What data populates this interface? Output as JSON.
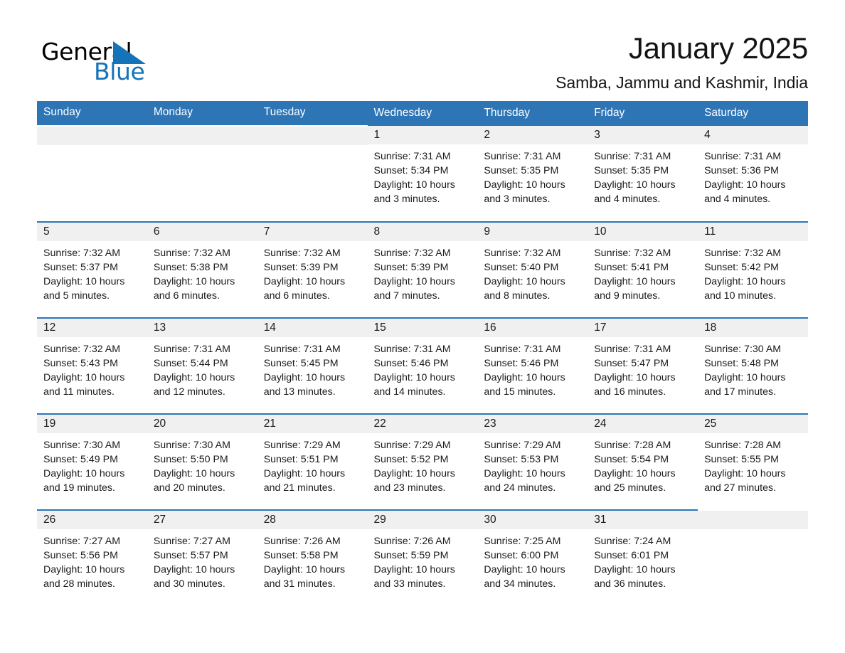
{
  "brand": {
    "word1": "General",
    "word2": "Blue",
    "triangle_color": "#1573b9",
    "triangle_icon": "triangle-logo-icon"
  },
  "header": {
    "title": "January 2025",
    "location": "Samba, Jammu and Kashmir, India"
  },
  "theme": {
    "header_blue": "#2e75b6",
    "daynum_band": "#f0f0f0",
    "text": "#1a1a1a"
  },
  "calendar": {
    "weekday_headers": [
      "Sunday",
      "Monday",
      "Tuesday",
      "Wednesday",
      "Thursday",
      "Friday",
      "Saturday"
    ],
    "weeks": [
      [
        {
          "empty": true
        },
        {
          "empty": true
        },
        {
          "empty": true
        },
        {
          "day": "1",
          "sunrise": "Sunrise: 7:31 AM",
          "sunset": "Sunset: 5:34 PM",
          "daylight_line1": "Daylight: 10 hours",
          "daylight_line2": "and 3 minutes."
        },
        {
          "day": "2",
          "sunrise": "Sunrise: 7:31 AM",
          "sunset": "Sunset: 5:35 PM",
          "daylight_line1": "Daylight: 10 hours",
          "daylight_line2": "and 3 minutes."
        },
        {
          "day": "3",
          "sunrise": "Sunrise: 7:31 AM",
          "sunset": "Sunset: 5:35 PM",
          "daylight_line1": "Daylight: 10 hours",
          "daylight_line2": "and 4 minutes."
        },
        {
          "day": "4",
          "sunrise": "Sunrise: 7:31 AM",
          "sunset": "Sunset: 5:36 PM",
          "daylight_line1": "Daylight: 10 hours",
          "daylight_line2": "and 4 minutes."
        }
      ],
      [
        {
          "day": "5",
          "sunrise": "Sunrise: 7:32 AM",
          "sunset": "Sunset: 5:37 PM",
          "daylight_line1": "Daylight: 10 hours",
          "daylight_line2": "and 5 minutes."
        },
        {
          "day": "6",
          "sunrise": "Sunrise: 7:32 AM",
          "sunset": "Sunset: 5:38 PM",
          "daylight_line1": "Daylight: 10 hours",
          "daylight_line2": "and 6 minutes."
        },
        {
          "day": "7",
          "sunrise": "Sunrise: 7:32 AM",
          "sunset": "Sunset: 5:39 PM",
          "daylight_line1": "Daylight: 10 hours",
          "daylight_line2": "and 6 minutes."
        },
        {
          "day": "8",
          "sunrise": "Sunrise: 7:32 AM",
          "sunset": "Sunset: 5:39 PM",
          "daylight_line1": "Daylight: 10 hours",
          "daylight_line2": "and 7 minutes."
        },
        {
          "day": "9",
          "sunrise": "Sunrise: 7:32 AM",
          "sunset": "Sunset: 5:40 PM",
          "daylight_line1": "Daylight: 10 hours",
          "daylight_line2": "and 8 minutes."
        },
        {
          "day": "10",
          "sunrise": "Sunrise: 7:32 AM",
          "sunset": "Sunset: 5:41 PM",
          "daylight_line1": "Daylight: 10 hours",
          "daylight_line2": "and 9 minutes."
        },
        {
          "day": "11",
          "sunrise": "Sunrise: 7:32 AM",
          "sunset": "Sunset: 5:42 PM",
          "daylight_line1": "Daylight: 10 hours",
          "daylight_line2": "and 10 minutes."
        }
      ],
      [
        {
          "day": "12",
          "sunrise": "Sunrise: 7:32 AM",
          "sunset": "Sunset: 5:43 PM",
          "daylight_line1": "Daylight: 10 hours",
          "daylight_line2": "and 11 minutes."
        },
        {
          "day": "13",
          "sunrise": "Sunrise: 7:31 AM",
          "sunset": "Sunset: 5:44 PM",
          "daylight_line1": "Daylight: 10 hours",
          "daylight_line2": "and 12 minutes."
        },
        {
          "day": "14",
          "sunrise": "Sunrise: 7:31 AM",
          "sunset": "Sunset: 5:45 PM",
          "daylight_line1": "Daylight: 10 hours",
          "daylight_line2": "and 13 minutes."
        },
        {
          "day": "15",
          "sunrise": "Sunrise: 7:31 AM",
          "sunset": "Sunset: 5:46 PM",
          "daylight_line1": "Daylight: 10 hours",
          "daylight_line2": "and 14 minutes."
        },
        {
          "day": "16",
          "sunrise": "Sunrise: 7:31 AM",
          "sunset": "Sunset: 5:46 PM",
          "daylight_line1": "Daylight: 10 hours",
          "daylight_line2": "and 15 minutes."
        },
        {
          "day": "17",
          "sunrise": "Sunrise: 7:31 AM",
          "sunset": "Sunset: 5:47 PM",
          "daylight_line1": "Daylight: 10 hours",
          "daylight_line2": "and 16 minutes."
        },
        {
          "day": "18",
          "sunrise": "Sunrise: 7:30 AM",
          "sunset": "Sunset: 5:48 PM",
          "daylight_line1": "Daylight: 10 hours",
          "daylight_line2": "and 17 minutes."
        }
      ],
      [
        {
          "day": "19",
          "sunrise": "Sunrise: 7:30 AM",
          "sunset": "Sunset: 5:49 PM",
          "daylight_line1": "Daylight: 10 hours",
          "daylight_line2": "and 19 minutes."
        },
        {
          "day": "20",
          "sunrise": "Sunrise: 7:30 AM",
          "sunset": "Sunset: 5:50 PM",
          "daylight_line1": "Daylight: 10 hours",
          "daylight_line2": "and 20 minutes."
        },
        {
          "day": "21",
          "sunrise": "Sunrise: 7:29 AM",
          "sunset": "Sunset: 5:51 PM",
          "daylight_line1": "Daylight: 10 hours",
          "daylight_line2": "and 21 minutes."
        },
        {
          "day": "22",
          "sunrise": "Sunrise: 7:29 AM",
          "sunset": "Sunset: 5:52 PM",
          "daylight_line1": "Daylight: 10 hours",
          "daylight_line2": "and 23 minutes."
        },
        {
          "day": "23",
          "sunrise": "Sunrise: 7:29 AM",
          "sunset": "Sunset: 5:53 PM",
          "daylight_line1": "Daylight: 10 hours",
          "daylight_line2": "and 24 minutes."
        },
        {
          "day": "24",
          "sunrise": "Sunrise: 7:28 AM",
          "sunset": "Sunset: 5:54 PM",
          "daylight_line1": "Daylight: 10 hours",
          "daylight_line2": "and 25 minutes."
        },
        {
          "day": "25",
          "sunrise": "Sunrise: 7:28 AM",
          "sunset": "Sunset: 5:55 PM",
          "daylight_line1": "Daylight: 10 hours",
          "daylight_line2": "and 27 minutes."
        }
      ],
      [
        {
          "day": "26",
          "sunrise": "Sunrise: 7:27 AM",
          "sunset": "Sunset: 5:56 PM",
          "daylight_line1": "Daylight: 10 hours",
          "daylight_line2": "and 28 minutes."
        },
        {
          "day": "27",
          "sunrise": "Sunrise: 7:27 AM",
          "sunset": "Sunset: 5:57 PM",
          "daylight_line1": "Daylight: 10 hours",
          "daylight_line2": "and 30 minutes."
        },
        {
          "day": "28",
          "sunrise": "Sunrise: 7:26 AM",
          "sunset": "Sunset: 5:58 PM",
          "daylight_line1": "Daylight: 10 hours",
          "daylight_line2": "and 31 minutes."
        },
        {
          "day": "29",
          "sunrise": "Sunrise: 7:26 AM",
          "sunset": "Sunset: 5:59 PM",
          "daylight_line1": "Daylight: 10 hours",
          "daylight_line2": "and 33 minutes."
        },
        {
          "day": "30",
          "sunrise": "Sunrise: 7:25 AM",
          "sunset": "Sunset: 6:00 PM",
          "daylight_line1": "Daylight: 10 hours",
          "daylight_line2": "and 34 minutes."
        },
        {
          "day": "31",
          "sunrise": "Sunrise: 7:24 AM",
          "sunset": "Sunset: 6:01 PM",
          "daylight_line1": "Daylight: 10 hours",
          "daylight_line2": "and 36 minutes."
        },
        {
          "empty": true
        }
      ]
    ]
  }
}
